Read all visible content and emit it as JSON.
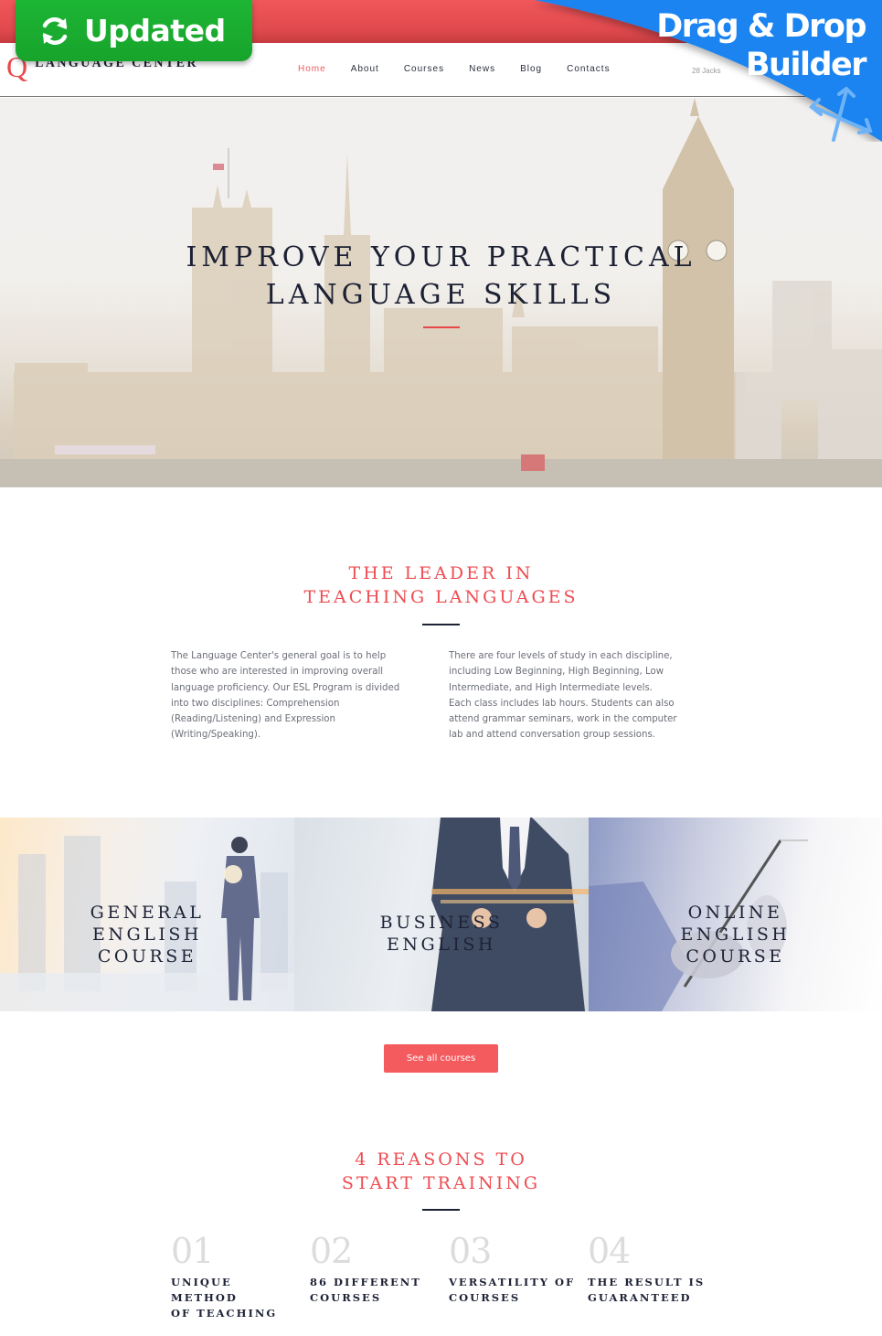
{
  "badge": {
    "label": "Updated",
    "icon": "refresh-icon"
  },
  "ribbon": {
    "line1": "Drag & Drop",
    "line2": "Builder",
    "icon": "move-arrows-icon"
  },
  "header": {
    "logo_letter": "Q",
    "logo_text": "LANGUAGE CENTER",
    "address": "28 Jacks",
    "nav": [
      {
        "label": "Home",
        "active": true
      },
      {
        "label": "About",
        "active": false
      },
      {
        "label": "Courses",
        "active": false
      },
      {
        "label": "News",
        "active": false
      },
      {
        "label": "Blog",
        "active": false
      },
      {
        "label": "Contacts",
        "active": false
      }
    ]
  },
  "hero": {
    "title_line1": "IMPROVE YOUR PRACTICAL",
    "title_line2": "LANGUAGE SKILLS"
  },
  "leader": {
    "title_line1": "THE LEADER IN",
    "title_line2": "TEACHING LANGUAGES",
    "col1": "The Language Center's general goal is to help those who are interested in improving overall language proficiency. Our ESL Program is divided into two disciplines: Comprehension (Reading/Listening) and Expression (Writing/Speaking).",
    "col2": "There are four levels of study in each discipline, including Low Beginning, High Beginning, Low Intermediate, and High Intermediate levels. Each class includes lab hours. Students can also attend grammar seminars, work in the computer lab and attend conversation group sessions."
  },
  "courses": [
    {
      "lines": [
        "GENERAL",
        "ENGLISH",
        "COURSE"
      ]
    },
    {
      "lines": [
        "BUSINESS",
        "ENGLISH"
      ]
    },
    {
      "lines": [
        "ONLINE",
        "ENGLISH",
        "COURSE"
      ]
    }
  ],
  "see_all_button": "See all courses",
  "reasons": {
    "title_line1": "4 REASONS TO",
    "title_line2": "START TRAINING",
    "items": [
      {
        "num": "01",
        "line1": "UNIQUE METHOD",
        "line2": "OF TEACHING"
      },
      {
        "num": "02",
        "line1": "86 DIFFERENT",
        "line2": "COURSES"
      },
      {
        "num": "03",
        "line1": "VERSATILITY OF",
        "line2": "COURSES"
      },
      {
        "num": "04",
        "line1": "THE RESULT IS",
        "line2": "GUARANTEED"
      }
    ]
  },
  "colors": {
    "accent": "#ee4c51",
    "dark": "#1d2235",
    "badge_green": "#1db534",
    "ribbon_blue": "#1a84f0"
  }
}
